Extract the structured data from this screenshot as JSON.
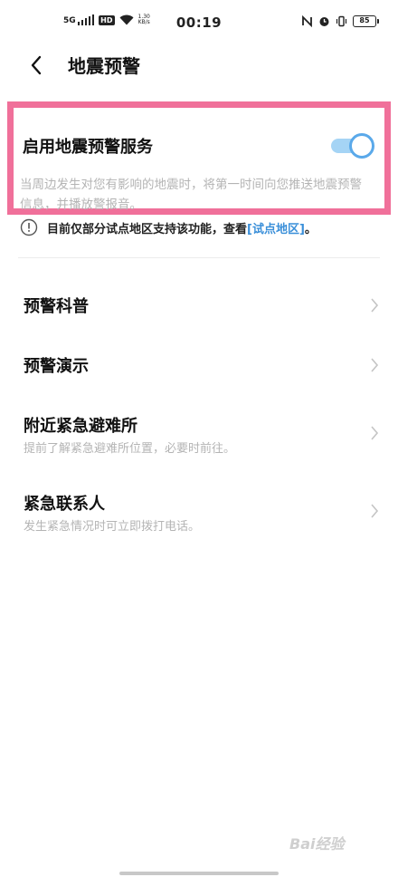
{
  "status_bar": {
    "network": "5G",
    "hd": "HD",
    "speed_value": "1.30",
    "speed_unit": "KB/s",
    "time": "00:19",
    "battery": "85",
    "icons": [
      "signal-icon",
      "wifi-icon",
      "nfc-icon",
      "alarm-icon",
      "vibrate-icon",
      "battery-icon"
    ]
  },
  "header": {
    "title": "地震预警"
  },
  "main_setting": {
    "label": "启用地震预警服务",
    "enabled": true,
    "description": "当周边发生对您有影响的地震时，将第一时间向您推送地震预警信息，并播放警报音。",
    "highlight_color": "#f0709a",
    "accent_color": "#5aa9ea"
  },
  "notice": {
    "text": "目前仅部分试点地区支持该功能，查看",
    "link": "[试点地区]",
    "suffix": "。"
  },
  "list": [
    {
      "title": "预警科普",
      "subtitle": ""
    },
    {
      "title": "预警演示",
      "subtitle": ""
    },
    {
      "title": "附近紧急避难所",
      "subtitle": "提前了解紧急避难所位置，必要时前往。"
    },
    {
      "title": "紧急联系人",
      "subtitle": "发生紧急情况时可立即拨打电话。"
    }
  ],
  "watermark": "Bai经验"
}
